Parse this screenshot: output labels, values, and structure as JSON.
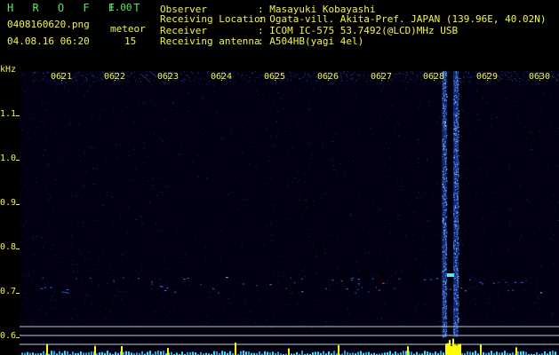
{
  "header": {
    "app_logo": "H R O F F T",
    "version": "1.00",
    "filename": "0408160620.png",
    "datetime": "04.08.16 06:20",
    "meteor_label": "meteor",
    "meteor_count": "15"
  },
  "info": [
    {
      "label": "Observer",
      "value": ": Masayuki Kobayashi"
    },
    {
      "label": "Receiving Location",
      "value": ": Ogata-vill. Akita-Pref. JAPAN (139.96E, 40.02N)"
    },
    {
      "label": "Receiver",
      "value": ": ICOM IC-575 53.7492(@LCD)MHz USB"
    },
    {
      "label": "Receiving antenna",
      "value": ": A504HB(yagi 4el)"
    }
  ],
  "spectrogram": {
    "unit_label": "kHz",
    "time_labels": [
      "0621",
      "0622",
      "0623",
      "0624",
      "0625",
      "0626",
      "0627",
      "0628",
      "0629",
      "0630"
    ],
    "freq_labels": [
      "1.1",
      "1.0",
      "0.9",
      "0.8",
      "0.7",
      "0.6"
    ],
    "colors": {
      "text": "#f3f34a",
      "background": "#000010",
      "signal": "#3b82ff",
      "peak": "#ffff00"
    }
  }
}
